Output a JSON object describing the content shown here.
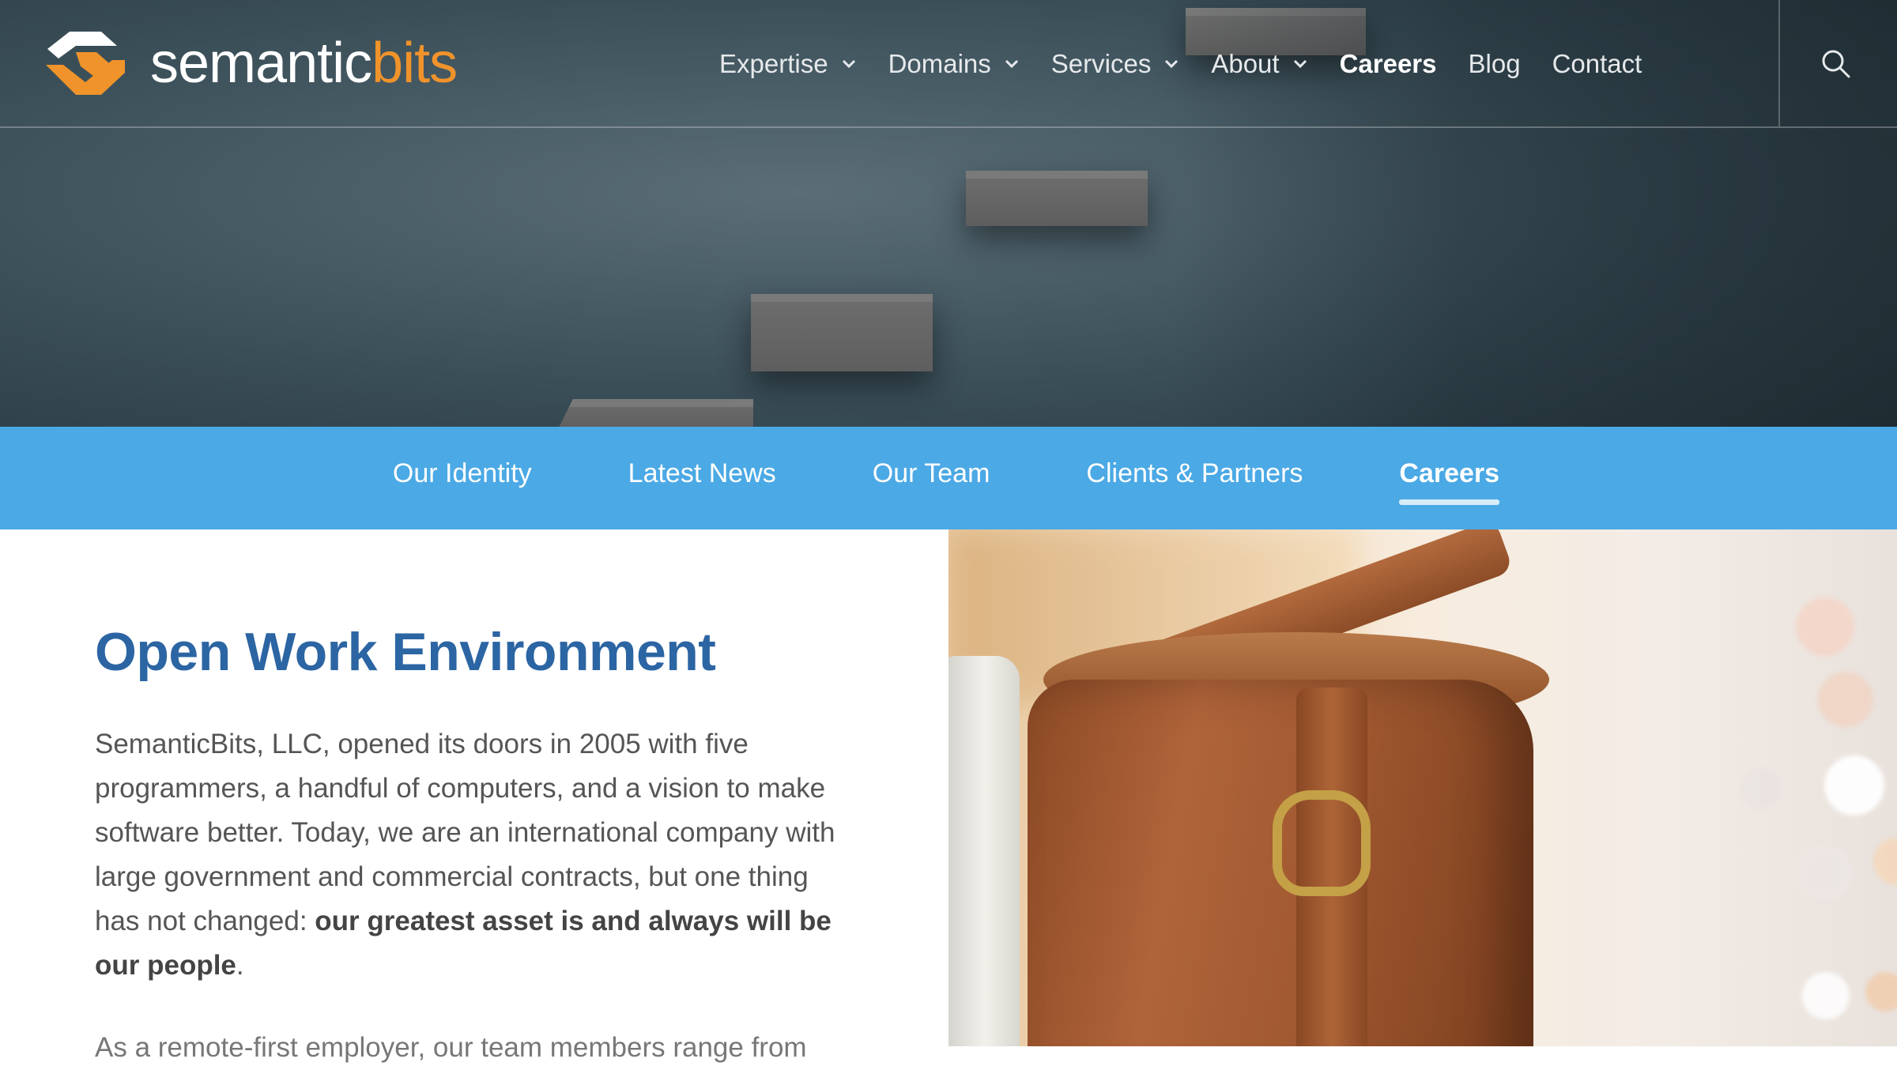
{
  "brand": {
    "part1": "semantic",
    "part2": "bits",
    "accent_color": "#f0932b"
  },
  "nav": {
    "items": [
      {
        "label": "Expertise",
        "dropdown": true
      },
      {
        "label": "Domains",
        "dropdown": true
      },
      {
        "label": "Services",
        "dropdown": true
      },
      {
        "label": "About",
        "dropdown": true
      },
      {
        "label": "Careers",
        "dropdown": false,
        "active": true
      },
      {
        "label": "Blog",
        "dropdown": false
      },
      {
        "label": "Contact",
        "dropdown": false
      }
    ],
    "search_icon": "search-icon"
  },
  "subnav": {
    "color": "#4ba9e5",
    "items": [
      {
        "label": "Our Identity"
      },
      {
        "label": "Latest News"
      },
      {
        "label": "Our Team"
      },
      {
        "label": "Clients & Partners"
      },
      {
        "label": "Careers",
        "active": true
      }
    ]
  },
  "content": {
    "heading": "Open Work Environment",
    "heading_color": "#2c65a3",
    "para1_text": "SemanticBits, LLC, opened its doors in 2005 with five programmers, a handful of computers, and a vision to make software better. Today, we are an international company with large government and commercial contracts, but one thing has not changed: ",
    "para1_bold": "our greatest asset is and always will be our people",
    "para1_end": ".",
    "para2_text": "As a remote-first employer, our team members range from"
  }
}
